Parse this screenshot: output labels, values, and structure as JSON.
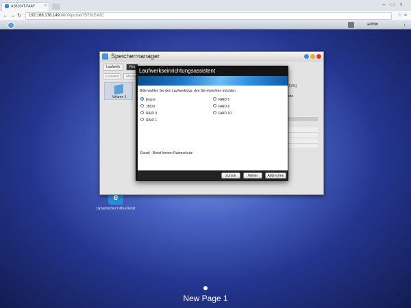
{
  "browser": {
    "tab_title": "AS6104T-FAAF",
    "url_host": "192.168.178.149",
    "url_rest": ":8000/portal/?5791E42C"
  },
  "nas": {
    "username": "admin"
  },
  "storage_manager": {
    "title": "Speichermanager",
    "tabs": [
      "Laufwerk",
      "Fes"
    ],
    "buttons": [
      "Erstellen",
      "Manag"
    ],
    "volume_label": "Volume 1",
    "side_text_1": "[13%]",
    "side_text_2": "atte"
  },
  "wizard": {
    "title": "Laufwerkseinrichtungsassistent",
    "prompt": "Bitte wählen Sie den Laufwerkstyp, den Sie einrichten möchten",
    "options_left": [
      "Einzel",
      "JBOD",
      "RAID 0",
      "RAID 1"
    ],
    "options_right": [
      "RAID 5",
      "RAID 6",
      "RAID 10"
    ],
    "selected": "Einzel",
    "description": "Einzel : Bietet keinen Datenschutz",
    "buttons": {
      "back": "Zurück",
      "next": "Weiter",
      "cancel": "Abbrechen"
    }
  },
  "desktop": {
    "app_label": "Dynamischer DNS-Dienst",
    "page_name": "New Page 1"
  },
  "colors": {
    "wizard_banner": "#1b79c9",
    "desktop_center": "#8fa7e9",
    "desktop_edge": "#131c50"
  }
}
